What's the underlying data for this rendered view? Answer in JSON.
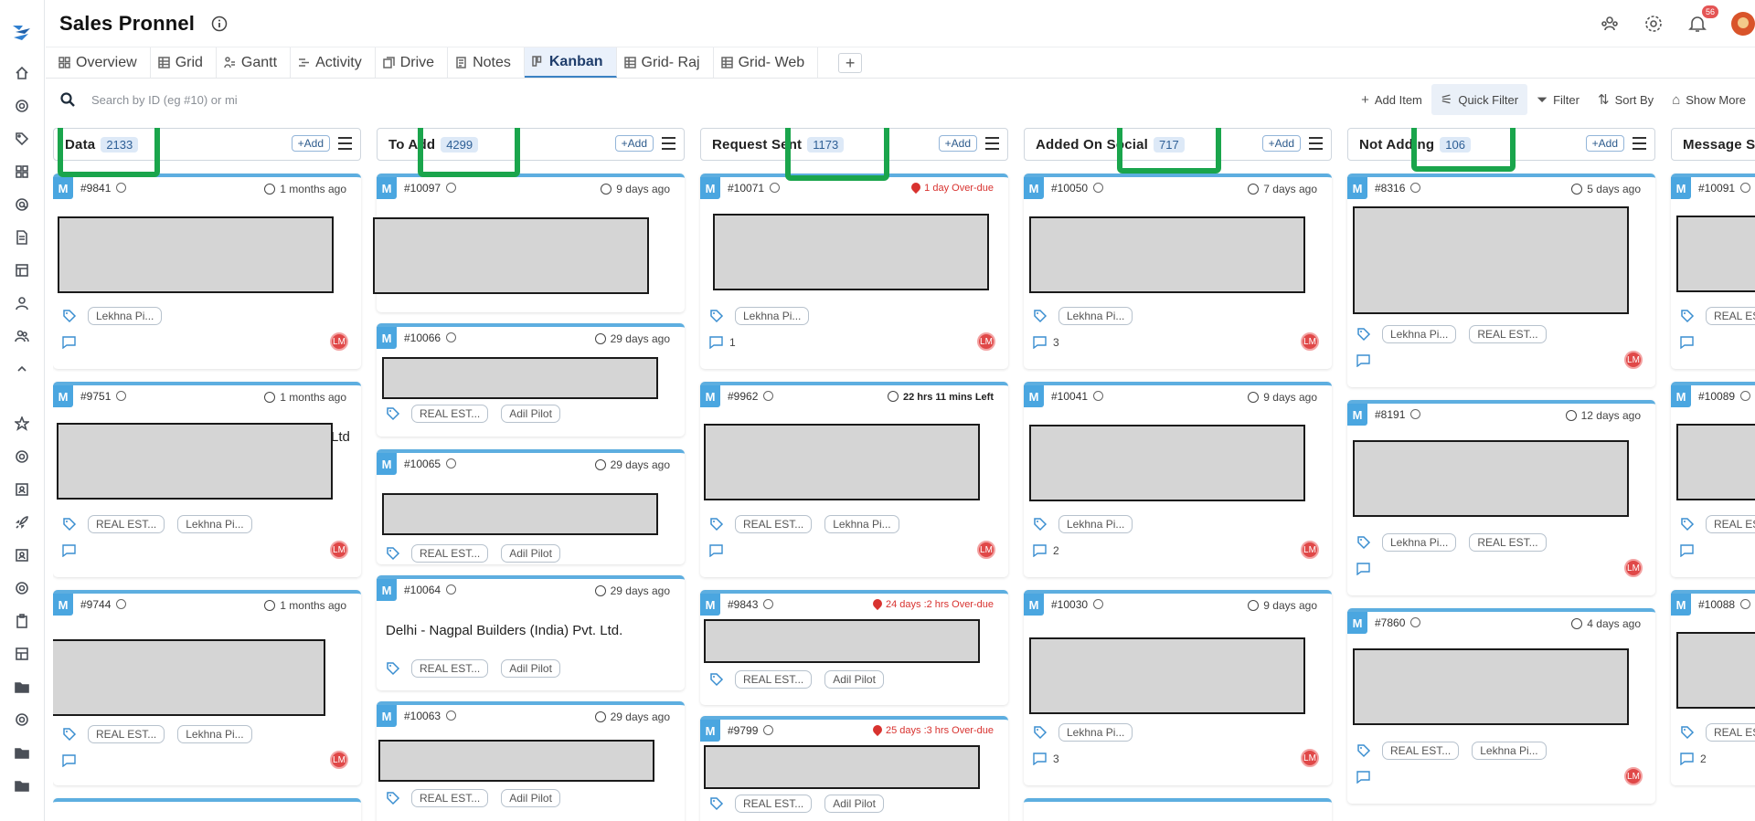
{
  "app": {
    "title": "Sales Pronnel",
    "notification_count": "56"
  },
  "tabs": [
    {
      "label": "Overview",
      "icon": "overview-icon"
    },
    {
      "label": "Grid",
      "icon": "grid-icon"
    },
    {
      "label": "Gantt",
      "icon": "gantt-icon"
    },
    {
      "label": "Activity",
      "icon": "activity-icon"
    },
    {
      "label": "Drive",
      "icon": "drive-icon"
    },
    {
      "label": "Notes",
      "icon": "notes-icon"
    },
    {
      "label": "Kanban",
      "icon": "kanban-icon",
      "active": true
    },
    {
      "label": "Grid- Raj",
      "icon": "grid-icon"
    },
    {
      "label": "Grid- Web",
      "icon": "grid-icon"
    }
  ],
  "toolbar": {
    "search_placeholder": "Search by ID (eg #10) or mi",
    "add_item": "Add Item",
    "quick_filter": "Quick Filter",
    "filter": "Filter",
    "sort_by": "Sort By",
    "show_more": "Show More"
  },
  "columns": [
    {
      "title": "Data",
      "count": "2133",
      "add": "+Add",
      "cards": [
        {
          "id": "#9841",
          "time": "1 months ago",
          "tags": [
            "Lekhna Pi..."
          ],
          "comments": "",
          "avatar": "LM"
        },
        {
          "id": "#9751",
          "time": "1 months ago",
          "fragment": "Ltd",
          "tags": [
            "REAL EST...",
            "Lekhna Pi..."
          ],
          "comments": "",
          "avatar": "LM"
        },
        {
          "id": "#9744",
          "time": "1 months ago",
          "tags": [
            "REAL EST...",
            "Lekhna Pi..."
          ],
          "comments": "",
          "avatar": "LM"
        }
      ]
    },
    {
      "title": "To Add",
      "count": "4299",
      "add": "+Add",
      "cards": [
        {
          "id": "#10097",
          "time": "9 days ago",
          "tags": [],
          "comments": ""
        },
        {
          "id": "#10066",
          "time": "29 days ago",
          "tags": [
            "REAL EST...",
            "Adil Pilot"
          ]
        },
        {
          "id": "#10065",
          "time": "29 days ago",
          "tags": [
            "REAL EST...",
            "Adil Pilot"
          ]
        },
        {
          "id": "#10064",
          "time": "29 days ago",
          "text": "Delhi - Nagpal Builders (India) Pvt. Ltd.",
          "tags": [
            "REAL EST...",
            "Adil Pilot"
          ]
        },
        {
          "id": "#10063",
          "time": "29 days ago",
          "tags": [
            "REAL EST...",
            "Adil Pilot"
          ]
        }
      ]
    },
    {
      "title": "Request Sent",
      "count": "1173",
      "add": "+Add",
      "cards": [
        {
          "id": "#10071",
          "time": "1 day Over-due",
          "tags": [
            "Lekhna Pi..."
          ],
          "comments": "1",
          "avatar": "LM"
        },
        {
          "id": "#9962",
          "time": "22 hrs 11 mins Left",
          "tags": [
            "REAL EST...",
            "Lekhna Pi..."
          ],
          "comments": "",
          "avatar": "LM"
        },
        {
          "id": "#9843",
          "time": "24 days :2 hrs Over-due",
          "tags": [
            "REAL EST...",
            "Adil Pilot"
          ]
        },
        {
          "id": "#9799",
          "time": "25 days :3 hrs Over-due",
          "tags": [
            "REAL EST...",
            "Adil Pilot"
          ]
        }
      ]
    },
    {
      "title": "Added On Social",
      "count": "717",
      "add": "+Add",
      "cards": [
        {
          "id": "#10050",
          "time": "7 days ago",
          "tags": [
            "Lekhna Pi..."
          ],
          "comments": "3",
          "avatar": "LM"
        },
        {
          "id": "#10041",
          "time": "9 days ago",
          "tags": [
            "Lekhna Pi..."
          ],
          "comments": "2",
          "avatar": "LM"
        },
        {
          "id": "#10030",
          "time": "9 days ago",
          "tags": [
            "Lekhna Pi..."
          ],
          "comments": "3",
          "avatar": "LM"
        }
      ]
    },
    {
      "title": "Not Adding",
      "count": "106",
      "add": "+Add",
      "cards": [
        {
          "id": "#8316",
          "time": "5 days ago",
          "tags": [
            "Lekhna Pi...",
            "REAL EST..."
          ],
          "comments": "",
          "avatar": "LM"
        },
        {
          "id": "#8191",
          "time": "12 days ago",
          "tags": [
            "Lekhna Pi...",
            "REAL EST..."
          ],
          "comments": "",
          "avatar": "LM"
        },
        {
          "id": "#7860",
          "time": "4 days ago",
          "tags": [
            "REAL EST...",
            "Lekhna Pi..."
          ],
          "comments": "",
          "avatar": "LM"
        }
      ]
    },
    {
      "title": "Message Se",
      "count": "",
      "add": "",
      "cards": [
        {
          "id": "#10091",
          "tags": [
            "REAL EST"
          ]
        },
        {
          "id": "#10089",
          "tags": [
            "REAL EST"
          ]
        },
        {
          "id": "#10088",
          "tags": [
            "REAL EST"
          ],
          "comments": "2"
        }
      ]
    }
  ]
}
